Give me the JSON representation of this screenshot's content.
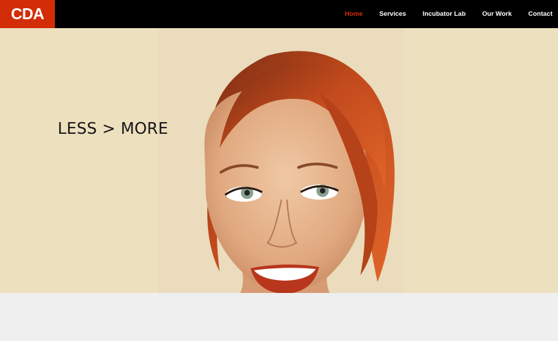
{
  "header": {
    "logo_text": "CDA",
    "brand_color": "#d22d06",
    "nav": [
      {
        "label": "Home",
        "active": true
      },
      {
        "label": "Services",
        "active": false
      },
      {
        "label": "Incubator Lab",
        "active": false
      },
      {
        "label": "Our Work",
        "active": false
      },
      {
        "label": "Contact",
        "active": false
      }
    ]
  },
  "hero": {
    "tagline": "LESS > MORE",
    "background_color": "#ede0bf"
  }
}
